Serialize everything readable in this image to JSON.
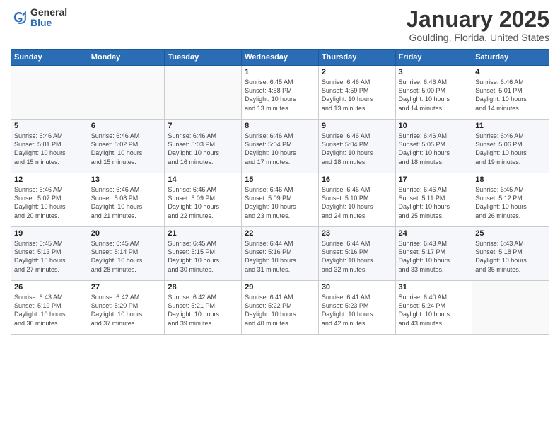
{
  "header": {
    "logo_general": "General",
    "logo_blue": "Blue",
    "title": "January 2025",
    "subtitle": "Goulding, Florida, United States"
  },
  "weekdays": [
    "Sunday",
    "Monday",
    "Tuesday",
    "Wednesday",
    "Thursday",
    "Friday",
    "Saturday"
  ],
  "weeks": [
    [
      {
        "day": "",
        "info": ""
      },
      {
        "day": "",
        "info": ""
      },
      {
        "day": "",
        "info": ""
      },
      {
        "day": "1",
        "info": "Sunrise: 6:45 AM\nSunset: 4:58 PM\nDaylight: 10 hours\nand 13 minutes."
      },
      {
        "day": "2",
        "info": "Sunrise: 6:46 AM\nSunset: 4:59 PM\nDaylight: 10 hours\nand 13 minutes."
      },
      {
        "day": "3",
        "info": "Sunrise: 6:46 AM\nSunset: 5:00 PM\nDaylight: 10 hours\nand 14 minutes."
      },
      {
        "day": "4",
        "info": "Sunrise: 6:46 AM\nSunset: 5:01 PM\nDaylight: 10 hours\nand 14 minutes."
      }
    ],
    [
      {
        "day": "5",
        "info": "Sunrise: 6:46 AM\nSunset: 5:01 PM\nDaylight: 10 hours\nand 15 minutes."
      },
      {
        "day": "6",
        "info": "Sunrise: 6:46 AM\nSunset: 5:02 PM\nDaylight: 10 hours\nand 15 minutes."
      },
      {
        "day": "7",
        "info": "Sunrise: 6:46 AM\nSunset: 5:03 PM\nDaylight: 10 hours\nand 16 minutes."
      },
      {
        "day": "8",
        "info": "Sunrise: 6:46 AM\nSunset: 5:04 PM\nDaylight: 10 hours\nand 17 minutes."
      },
      {
        "day": "9",
        "info": "Sunrise: 6:46 AM\nSunset: 5:04 PM\nDaylight: 10 hours\nand 18 minutes."
      },
      {
        "day": "10",
        "info": "Sunrise: 6:46 AM\nSunset: 5:05 PM\nDaylight: 10 hours\nand 18 minutes."
      },
      {
        "day": "11",
        "info": "Sunrise: 6:46 AM\nSunset: 5:06 PM\nDaylight: 10 hours\nand 19 minutes."
      }
    ],
    [
      {
        "day": "12",
        "info": "Sunrise: 6:46 AM\nSunset: 5:07 PM\nDaylight: 10 hours\nand 20 minutes."
      },
      {
        "day": "13",
        "info": "Sunrise: 6:46 AM\nSunset: 5:08 PM\nDaylight: 10 hours\nand 21 minutes."
      },
      {
        "day": "14",
        "info": "Sunrise: 6:46 AM\nSunset: 5:09 PM\nDaylight: 10 hours\nand 22 minutes."
      },
      {
        "day": "15",
        "info": "Sunrise: 6:46 AM\nSunset: 5:09 PM\nDaylight: 10 hours\nand 23 minutes."
      },
      {
        "day": "16",
        "info": "Sunrise: 6:46 AM\nSunset: 5:10 PM\nDaylight: 10 hours\nand 24 minutes."
      },
      {
        "day": "17",
        "info": "Sunrise: 6:46 AM\nSunset: 5:11 PM\nDaylight: 10 hours\nand 25 minutes."
      },
      {
        "day": "18",
        "info": "Sunrise: 6:45 AM\nSunset: 5:12 PM\nDaylight: 10 hours\nand 26 minutes."
      }
    ],
    [
      {
        "day": "19",
        "info": "Sunrise: 6:45 AM\nSunset: 5:13 PM\nDaylight: 10 hours\nand 27 minutes."
      },
      {
        "day": "20",
        "info": "Sunrise: 6:45 AM\nSunset: 5:14 PM\nDaylight: 10 hours\nand 28 minutes."
      },
      {
        "day": "21",
        "info": "Sunrise: 6:45 AM\nSunset: 5:15 PM\nDaylight: 10 hours\nand 30 minutes."
      },
      {
        "day": "22",
        "info": "Sunrise: 6:44 AM\nSunset: 5:16 PM\nDaylight: 10 hours\nand 31 minutes."
      },
      {
        "day": "23",
        "info": "Sunrise: 6:44 AM\nSunset: 5:16 PM\nDaylight: 10 hours\nand 32 minutes."
      },
      {
        "day": "24",
        "info": "Sunrise: 6:43 AM\nSunset: 5:17 PM\nDaylight: 10 hours\nand 33 minutes."
      },
      {
        "day": "25",
        "info": "Sunrise: 6:43 AM\nSunset: 5:18 PM\nDaylight: 10 hours\nand 35 minutes."
      }
    ],
    [
      {
        "day": "26",
        "info": "Sunrise: 6:43 AM\nSunset: 5:19 PM\nDaylight: 10 hours\nand 36 minutes."
      },
      {
        "day": "27",
        "info": "Sunrise: 6:42 AM\nSunset: 5:20 PM\nDaylight: 10 hours\nand 37 minutes."
      },
      {
        "day": "28",
        "info": "Sunrise: 6:42 AM\nSunset: 5:21 PM\nDaylight: 10 hours\nand 39 minutes."
      },
      {
        "day": "29",
        "info": "Sunrise: 6:41 AM\nSunset: 5:22 PM\nDaylight: 10 hours\nand 40 minutes."
      },
      {
        "day": "30",
        "info": "Sunrise: 6:41 AM\nSunset: 5:23 PM\nDaylight: 10 hours\nand 42 minutes."
      },
      {
        "day": "31",
        "info": "Sunrise: 6:40 AM\nSunset: 5:24 PM\nDaylight: 10 hours\nand 43 minutes."
      },
      {
        "day": "",
        "info": ""
      }
    ]
  ]
}
